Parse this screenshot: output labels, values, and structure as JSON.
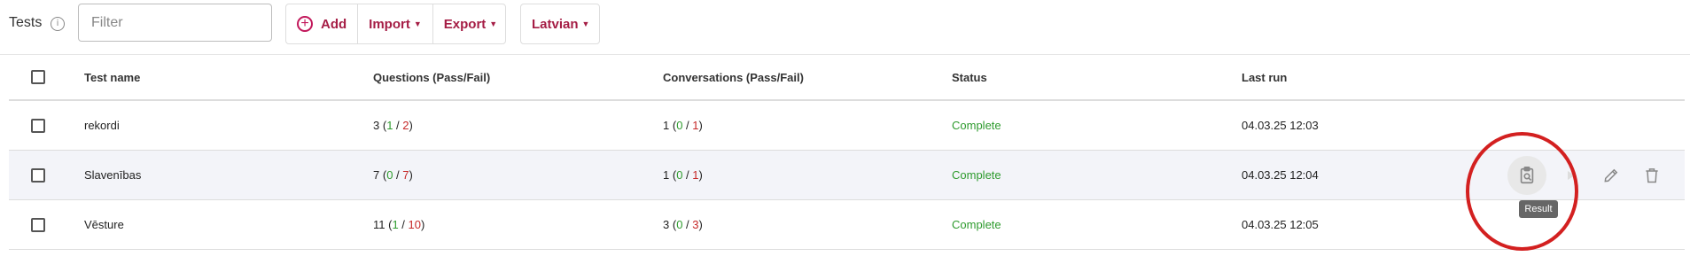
{
  "toolbar": {
    "title": "Tests",
    "filter_placeholder": "Filter",
    "add_label": "Add",
    "import_label": "Import",
    "export_label": "Export",
    "language_label": "Latvian"
  },
  "table": {
    "headers": {
      "name": "Test name",
      "questions": "Questions (Pass/Fail)",
      "conversations": "Conversations (Pass/Fail)",
      "status": "Status",
      "last_run": "Last run"
    },
    "rows": [
      {
        "name": "rekordi",
        "q_total": "3",
        "q_pass": "1",
        "q_fail": "2",
        "c_total": "1",
        "c_pass": "0",
        "c_fail": "1",
        "status": "Complete",
        "last_run": "04.03.25 12:03"
      },
      {
        "name": "Slavenības",
        "q_total": "7",
        "q_pass": "0",
        "q_fail": "7",
        "c_total": "1",
        "c_pass": "0",
        "c_fail": "1",
        "status": "Complete",
        "last_run": "04.03.25 12:04"
      },
      {
        "name": "Vēsture",
        "q_total": "11",
        "q_pass": "1",
        "q_fail": "10",
        "c_total": "3",
        "c_pass": "0",
        "c_fail": "3",
        "status": "Complete",
        "last_run": "04.03.25 12:05"
      }
    ]
  },
  "tooltip": {
    "text": "Result"
  },
  "colors": {
    "accent": "#a51d45",
    "pass": "#2e9b2e",
    "fail": "#c62828",
    "annotation": "#d32020"
  },
  "icons": {
    "info": "info-icon",
    "add": "plus-circle-icon",
    "result": "clipboard-search-icon",
    "run": "play-icon",
    "edit": "pencil-icon",
    "delete": "trash-icon"
  }
}
